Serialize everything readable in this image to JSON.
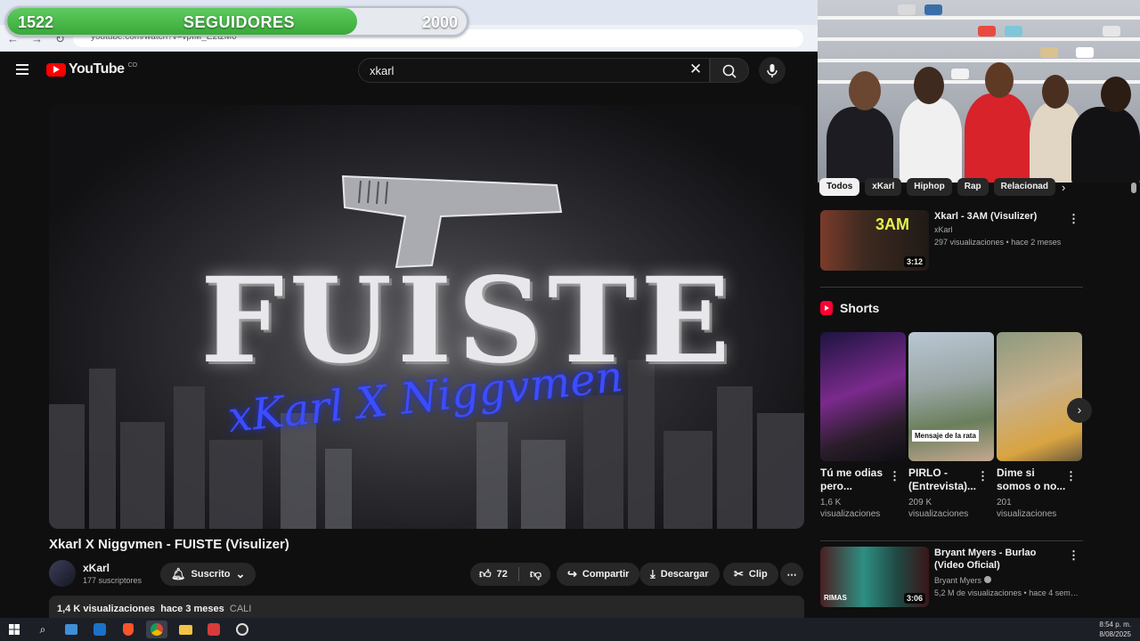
{
  "overlay": {
    "current": "1522",
    "label": "SEGUIDORES",
    "goal": "2000",
    "progress_fraction": 0.761
  },
  "browser": {
    "url": "youtube.com/watch?v=vpIM_E2tzM0"
  },
  "header": {
    "logo_text": "YouTube",
    "country": "CO",
    "search_value": "xkarl"
  },
  "video": {
    "title": "Xkarl X Niggvmen - FUISTE (Visulizer)",
    "channel": "xKarl",
    "subscribers": "177 suscriptores",
    "subscribe_label": "Suscrito",
    "likes": "72",
    "share_label": "Compartir",
    "download_label": "Descargar",
    "clip_label": "Clip",
    "views": "1,4 K visualizaciones",
    "age": "hace 3 meses",
    "location": "CALI",
    "art_title": "FUISTE",
    "art_signature": "xKarl X Niggvmen"
  },
  "chips": [
    "Todos",
    "xKarl",
    "Hiphop",
    "Rap",
    "Relacionad"
  ],
  "recommendations": [
    {
      "title": "Xkarl - 3AM  (Visulizer)",
      "channel": "xKarl",
      "meta": "297 visualizaciones • hace 2 meses",
      "duration": "3:12",
      "thumb_text": "3AM"
    },
    {
      "title": "Bryant Myers - Burlao (Video Oficial)",
      "channel": "Bryant Myers",
      "meta": "5,2 M de visualizaciones • hace 4 seman...",
      "duration": "3:06",
      "thumb_text": "RIMAS"
    }
  ],
  "shorts": {
    "title": "Shorts",
    "items": [
      {
        "title": "Tú me odias pero...",
        "views": "1,6 K visualizaciones"
      },
      {
        "title": "PIRLO - (Entrevista)...",
        "views": "209 K visualizaciones",
        "overlay": "Mensaje de la rata"
      },
      {
        "title": "Dime si somos o no...",
        "views": "201 visualizaciones"
      }
    ]
  },
  "taskbar": {
    "time": "8:54 p. m.",
    "date": "8/08/2025"
  },
  "colors": {
    "accent": "#ff0000",
    "progress": "#4bbb4b",
    "bg": "#0f0f0f"
  }
}
